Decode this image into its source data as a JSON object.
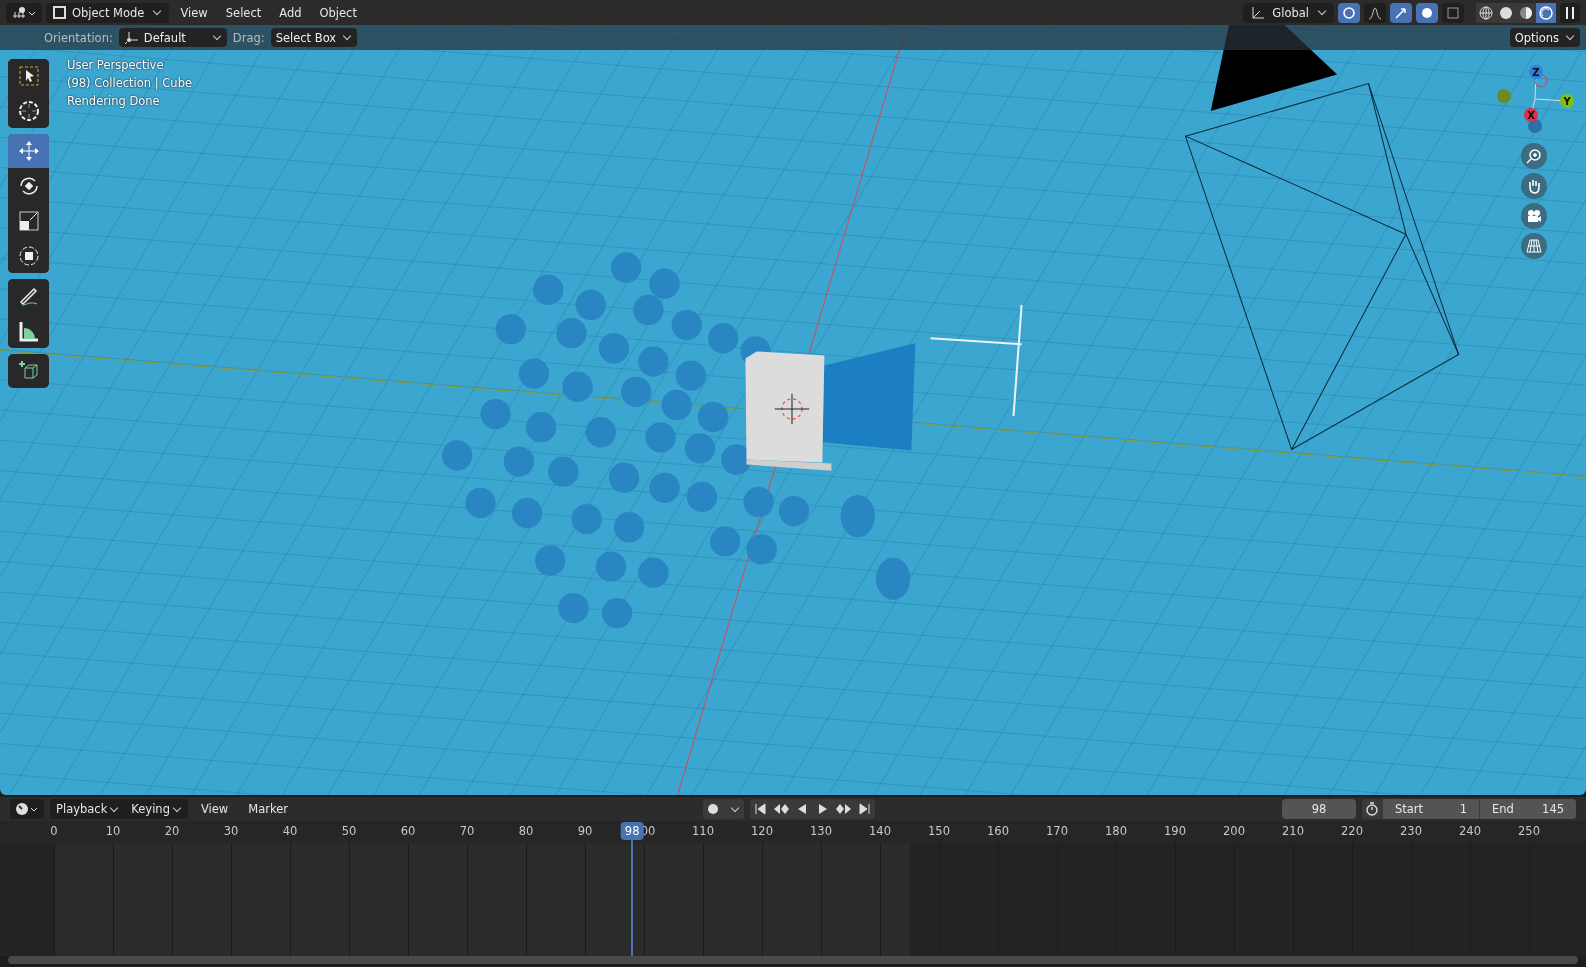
{
  "header": {
    "mode": "Object Mode",
    "menus": [
      "View",
      "Select",
      "Add",
      "Object"
    ],
    "transform_orientation": "Global",
    "toggles": [
      {
        "kind": "snap",
        "on": true
      },
      {
        "kind": "proportional",
        "on": false
      },
      {
        "kind": "gizmo",
        "on": true
      },
      {
        "kind": "overlay",
        "on": true
      },
      {
        "kind": "xray",
        "on": false
      }
    ],
    "shading_modes": [
      {
        "kind": "wireframe",
        "selected": false
      },
      {
        "kind": "solid",
        "selected": false
      },
      {
        "kind": "material",
        "selected": false
      },
      {
        "kind": "rendered",
        "selected": true
      }
    ]
  },
  "tool_settings": {
    "orientation_label": "Orientation:",
    "orientation": "Default",
    "drag_label": "Drag:",
    "drag": "Select Box",
    "options": "Options"
  },
  "viewport_info": [
    "User Perspective",
    "(98) Collection | Cube",
    "Rendering Done"
  ],
  "toolbar_groups": [
    {
      "tools": [
        {
          "kind": "select_box",
          "selected": false
        },
        {
          "kind": "cursor",
          "selected": false
        }
      ]
    },
    {
      "tools": [
        {
          "kind": "move",
          "selected": true
        },
        {
          "kind": "rotate",
          "selected": false
        },
        {
          "kind": "scale",
          "selected": false
        },
        {
          "kind": "transform",
          "selected": false
        }
      ]
    },
    {
      "tools": [
        {
          "kind": "annotate",
          "selected": false
        },
        {
          "kind": "measure",
          "selected": false
        }
      ]
    },
    {
      "tools": [
        {
          "kind": "add_cube",
          "selected": false
        }
      ]
    }
  ],
  "gizmo": {
    "z": "Z",
    "y": "Y",
    "x": "X"
  },
  "timeline": {
    "dropdowns": [
      "Playback",
      "Keying"
    ],
    "menus": [
      "View",
      "Marker"
    ],
    "auto_keying": false,
    "current_frame": "98",
    "playhead_frame": "98",
    "start_label": "Start",
    "start": "1",
    "end_label": "End",
    "end": "145",
    "ticks": [
      "0",
      "10",
      "20",
      "30",
      "40",
      "50",
      "60",
      "70",
      "80",
      "90",
      "00",
      "110",
      "120",
      "130",
      "140",
      "150",
      "160",
      "170",
      "180",
      "190",
      "200",
      "210",
      "220",
      "230",
      "240",
      "250"
    ]
  }
}
